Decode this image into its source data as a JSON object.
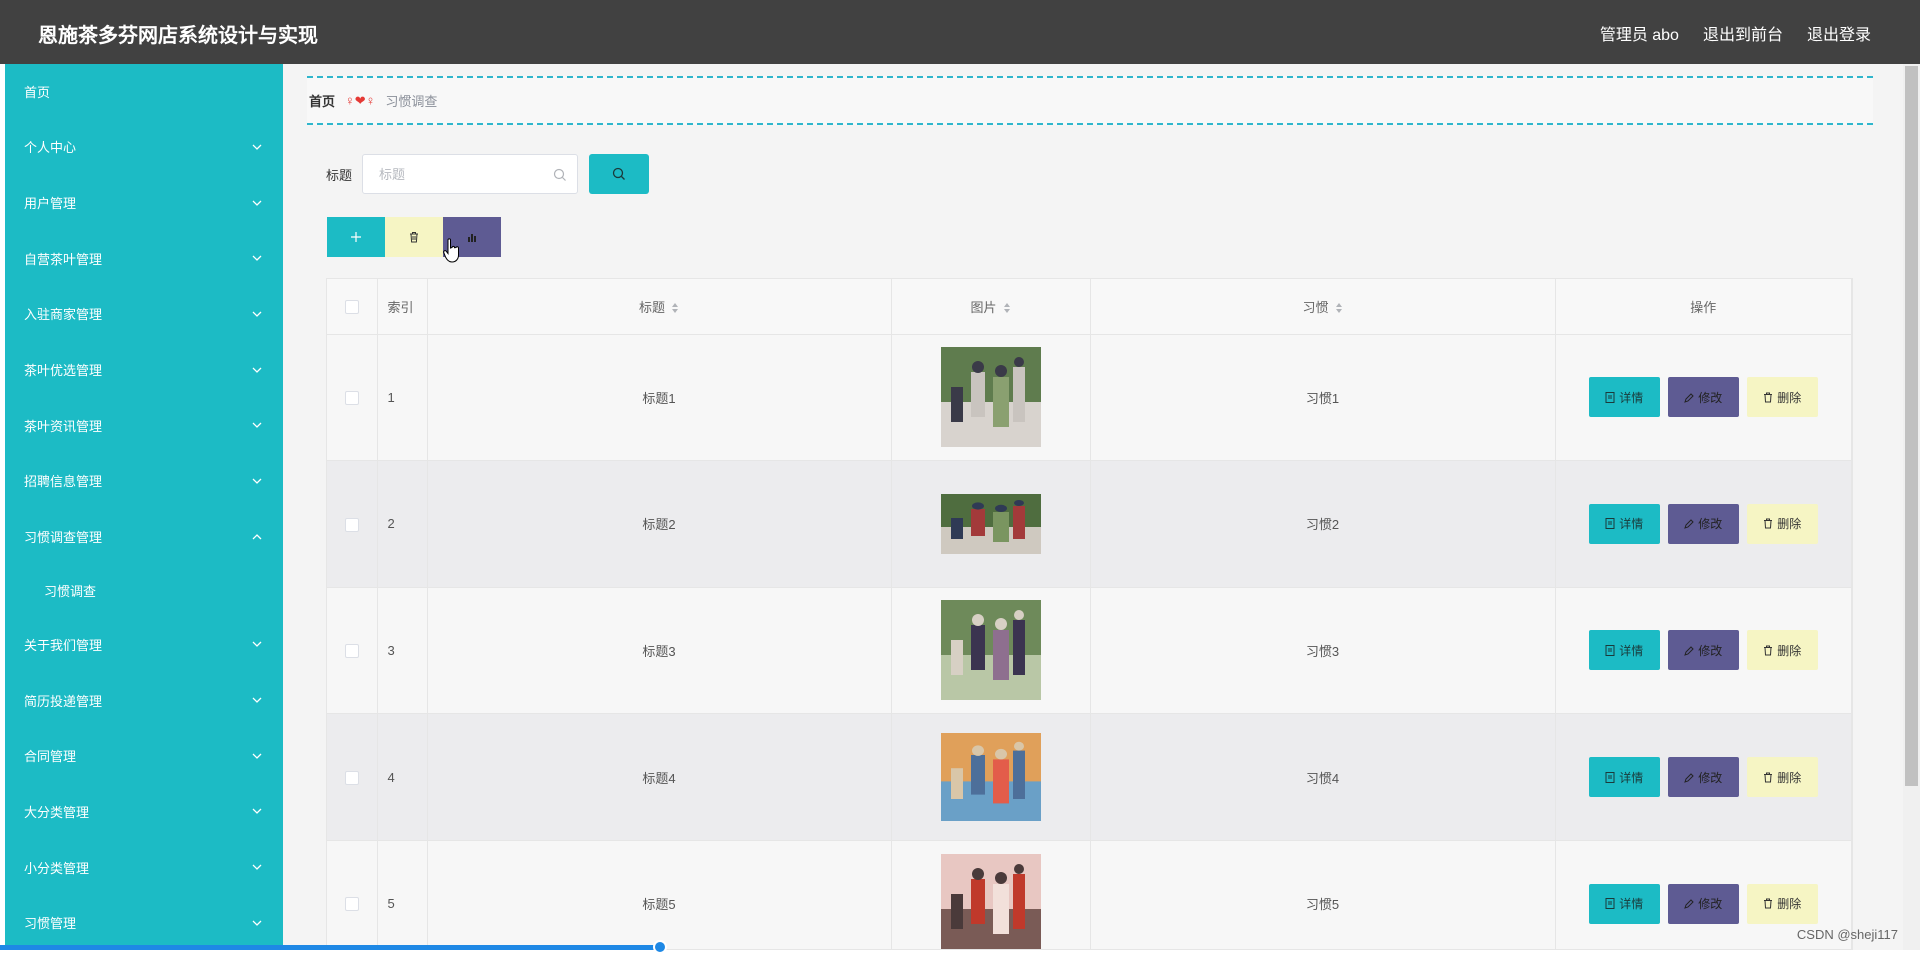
{
  "header": {
    "title": "恩施茶多芬网店系统设计与实现",
    "admin_label": "管理员 abo",
    "front_label": "退出到前台",
    "logout_label": "退出登录"
  },
  "sidebar": {
    "items": [
      {
        "label": "首页"
      },
      {
        "label": "个人中心"
      },
      {
        "label": "用户管理"
      },
      {
        "label": "自营茶叶管理"
      },
      {
        "label": "入驻商家管理"
      },
      {
        "label": "茶叶优选管理"
      },
      {
        "label": "茶叶资讯管理"
      },
      {
        "label": "招聘信息管理"
      },
      {
        "label": "习惯调查管理"
      },
      {
        "label": "关于我们管理"
      },
      {
        "label": "简历投递管理"
      },
      {
        "label": "合同管理"
      },
      {
        "label": "大分类管理"
      },
      {
        "label": "小分类管理"
      },
      {
        "label": "习惯管理"
      }
    ],
    "sub_item": "习惯调查"
  },
  "breadcrumb": {
    "home": "首页",
    "separator": "♀❤♀",
    "current": "习惯调查"
  },
  "search": {
    "label": "标题",
    "placeholder": "标题",
    "value": ""
  },
  "table": {
    "headers": {
      "index": "索引",
      "title": "标题",
      "image": "图片",
      "habit": "习惯",
      "actions": "操作"
    },
    "rows": [
      {
        "index": "1",
        "title": "标题1",
        "habit": "习惯1"
      },
      {
        "index": "2",
        "title": "标题2",
        "habit": "习惯2"
      },
      {
        "index": "3",
        "title": "标题3",
        "habit": "习惯3"
      },
      {
        "index": "4",
        "title": "标题4",
        "habit": "习惯4"
      },
      {
        "index": "5",
        "title": "标题5",
        "habit": "习惯5"
      }
    ],
    "detail_label": "详情",
    "edit_label": "修改",
    "delete_label": "删除"
  },
  "watermark": "CSDN @sheji117",
  "colors": {
    "accent": "#1cbbc5",
    "purple": "#5e5b93",
    "yellow": "#f6f5c4",
    "topbar": "#414141"
  }
}
